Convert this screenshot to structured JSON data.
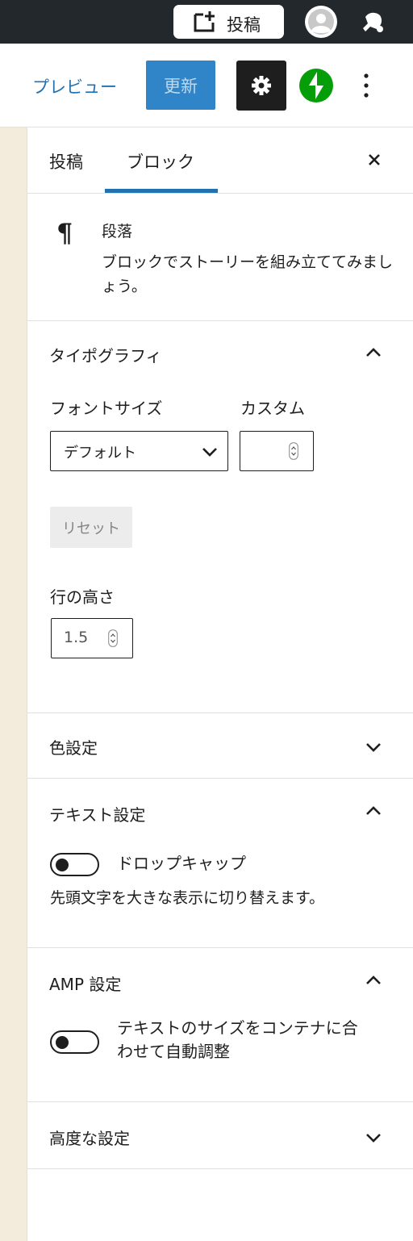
{
  "admin_bar": {
    "new_post_label": "投稿"
  },
  "header": {
    "preview_label": "プレビュー",
    "update_label": "更新"
  },
  "sidebar": {
    "tabs": [
      {
        "label": "投稿"
      },
      {
        "label": "ブロック"
      }
    ],
    "block": {
      "title": "段落",
      "description": "ブロックでストーリーを組み立ててみましょう。"
    },
    "typography": {
      "title": "タイポグラフィ",
      "font_size_label": "フォントサイズ",
      "custom_label": "カスタム",
      "font_size_value": "デフォルト",
      "reset_label": "リセット",
      "line_height_label": "行の高さ",
      "line_height_value": "1.5"
    },
    "color_settings": {
      "title": "色設定"
    },
    "text_settings": {
      "title": "テキスト設定",
      "drop_cap_label": "ドロップキャップ",
      "drop_cap_help": "先頭文字を大きな表示に切り替えます。"
    },
    "amp_settings": {
      "title": "AMP 設定",
      "auto_fit_label_line1": "テキストのサイズをコンテナに合",
      "auto_fit_label_line2": "わせて自動調整"
    },
    "advanced": {
      "title": "高度な設定"
    }
  },
  "colors": {
    "admin_bar_bg": "#23282d",
    "accent": "#2271b1",
    "update_bg": "#2f85c7",
    "settings_active_bg": "#1e1e1e",
    "jetpack_green": "#069e08",
    "left_strip_bg": "#f3ecdc"
  }
}
